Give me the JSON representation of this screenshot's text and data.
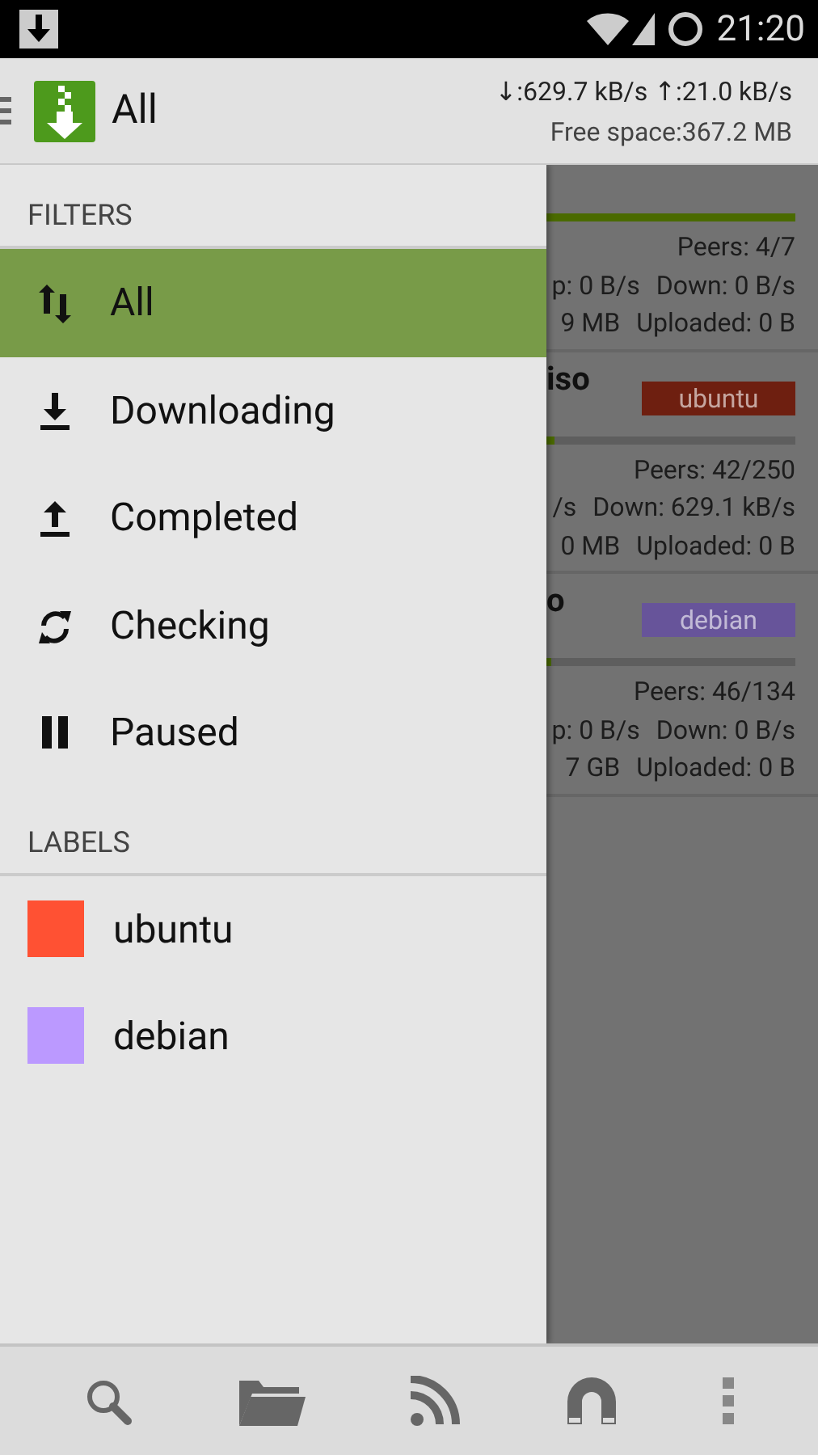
{
  "status_bar": {
    "time": "21:20"
  },
  "action_bar": {
    "title": "All",
    "speeds": "↓:629.7 kB/s ↑:21.0 kB/s",
    "free_space": "Free space:367.2 MB"
  },
  "drawer": {
    "filters_header": "FILTERS",
    "filters": [
      {
        "label": "All",
        "kind": "all",
        "selected": true
      },
      {
        "label": "Downloading",
        "kind": "downloading",
        "selected": false
      },
      {
        "label": "Completed",
        "kind": "completed",
        "selected": false
      },
      {
        "label": "Checking",
        "kind": "checking",
        "selected": false
      },
      {
        "label": "Paused",
        "kind": "paused",
        "selected": false
      }
    ],
    "labels_header": "LABELS",
    "labels": [
      {
        "label": "ubuntu",
        "color": "#ff5133"
      },
      {
        "label": "debian",
        "color": "#bb99ff"
      }
    ]
  },
  "torrents": [
    {
      "level": 1,
      "peers": "Peers: 4/7",
      "up": "p: 0 B/s",
      "down": "Down: 0 B/s",
      "size": "9 MB",
      "uploaded": "Uploaded: 0 B"
    },
    {
      "name": "iso",
      "tag": {
        "text": "ubuntu",
        "color": "#6e1f10"
      },
      "level": 0.03,
      "peers": "Peers: 42/250",
      "up": "/s",
      "down": "Down: 629.1 kB/s",
      "size": "0 MB",
      "uploaded": "Uploaded: 0 B"
    },
    {
      "name": "o",
      "tag": {
        "text": "debian",
        "color": "#67549a"
      },
      "level": 0.02,
      "peers": "Peers: 46/134",
      "up": "p: 0 B/s",
      "down": "Down: 0 B/s",
      "size": "7 GB",
      "uploaded": "Uploaded: 0 B"
    }
  ],
  "bottom_bar": {
    "buttons": [
      {
        "kind": "search"
      },
      {
        "kind": "folder"
      },
      {
        "kind": "rss"
      },
      {
        "kind": "magnet"
      },
      {
        "kind": "more"
      }
    ]
  }
}
